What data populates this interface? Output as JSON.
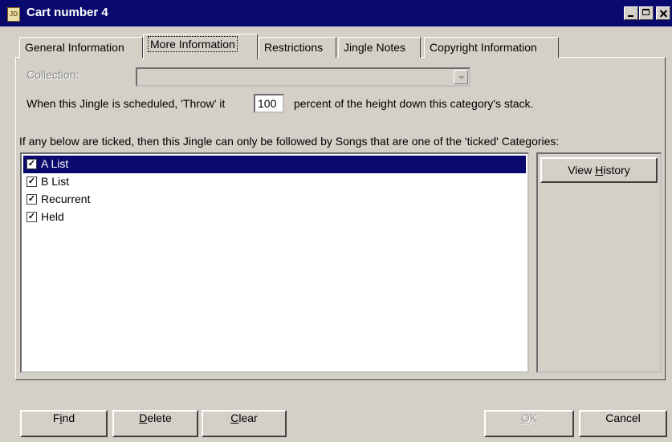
{
  "window": {
    "title": "Cart number 4",
    "icon": "app-icon",
    "icon_text": "JD"
  },
  "tabs": [
    {
      "label": "General Information"
    },
    {
      "label": "More Information"
    },
    {
      "label": "Restrictions"
    },
    {
      "label": "Jingle Notes"
    },
    {
      "label": "Copyright Information"
    }
  ],
  "active_tab": "More Information",
  "collection": {
    "label": "Collection:",
    "value": ""
  },
  "throw": {
    "prefix": "When this Jingle is scheduled, 'Throw' it",
    "value": "100",
    "suffix": "percent of the height down this category's stack."
  },
  "ticked_text": "If any below are ticked, then this Jingle can only be followed by Songs that are one of the 'ticked' Categories:",
  "categories": [
    {
      "label": "A List",
      "checked": true,
      "selected": true
    },
    {
      "label": "B List",
      "checked": true,
      "selected": false
    },
    {
      "label": "Recurrent",
      "checked": true,
      "selected": false
    },
    {
      "label": "Held",
      "checked": true,
      "selected": false
    }
  ],
  "buttons": {
    "view_history_pre": "View ",
    "view_history_key": "H",
    "view_history_post": "istory",
    "find_pre": "F",
    "find_key": "i",
    "find_post": "nd",
    "delete_key": "D",
    "delete_post": "elete",
    "clear_key": "C",
    "clear_post": "lear",
    "ok_key": "O",
    "ok_post": "K",
    "cancel": "Cancel"
  },
  "colors": {
    "titlebar": "#0a0a6e",
    "selection": "#0a0a6e",
    "face": "#d4d0c8"
  }
}
